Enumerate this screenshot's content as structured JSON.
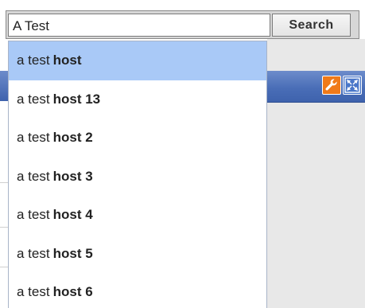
{
  "search": {
    "value": "A Test",
    "button_label": "Search"
  },
  "toolbar": {
    "wrench_icon": "wrench-icon",
    "fullscreen_icon": "fullscreen-icon",
    "wrench_color": "#f07a1a",
    "fullscreen_color": "#4a77c9"
  },
  "suggestions": [
    {
      "prefix": "a test",
      "match": "host",
      "selected": true
    },
    {
      "prefix": "a test",
      "match": "host 13",
      "selected": false
    },
    {
      "prefix": "a test",
      "match": "host 2",
      "selected": false
    },
    {
      "prefix": "a test",
      "match": "host 3",
      "selected": false
    },
    {
      "prefix": "a test",
      "match": "host 4",
      "selected": false
    },
    {
      "prefix": "a test",
      "match": "host 5",
      "selected": false
    },
    {
      "prefix": "a test",
      "match": "host 6",
      "selected": false
    }
  ],
  "colors": {
    "selected_row": "#a9c9f7",
    "header_bar": "#4a6eb7"
  }
}
